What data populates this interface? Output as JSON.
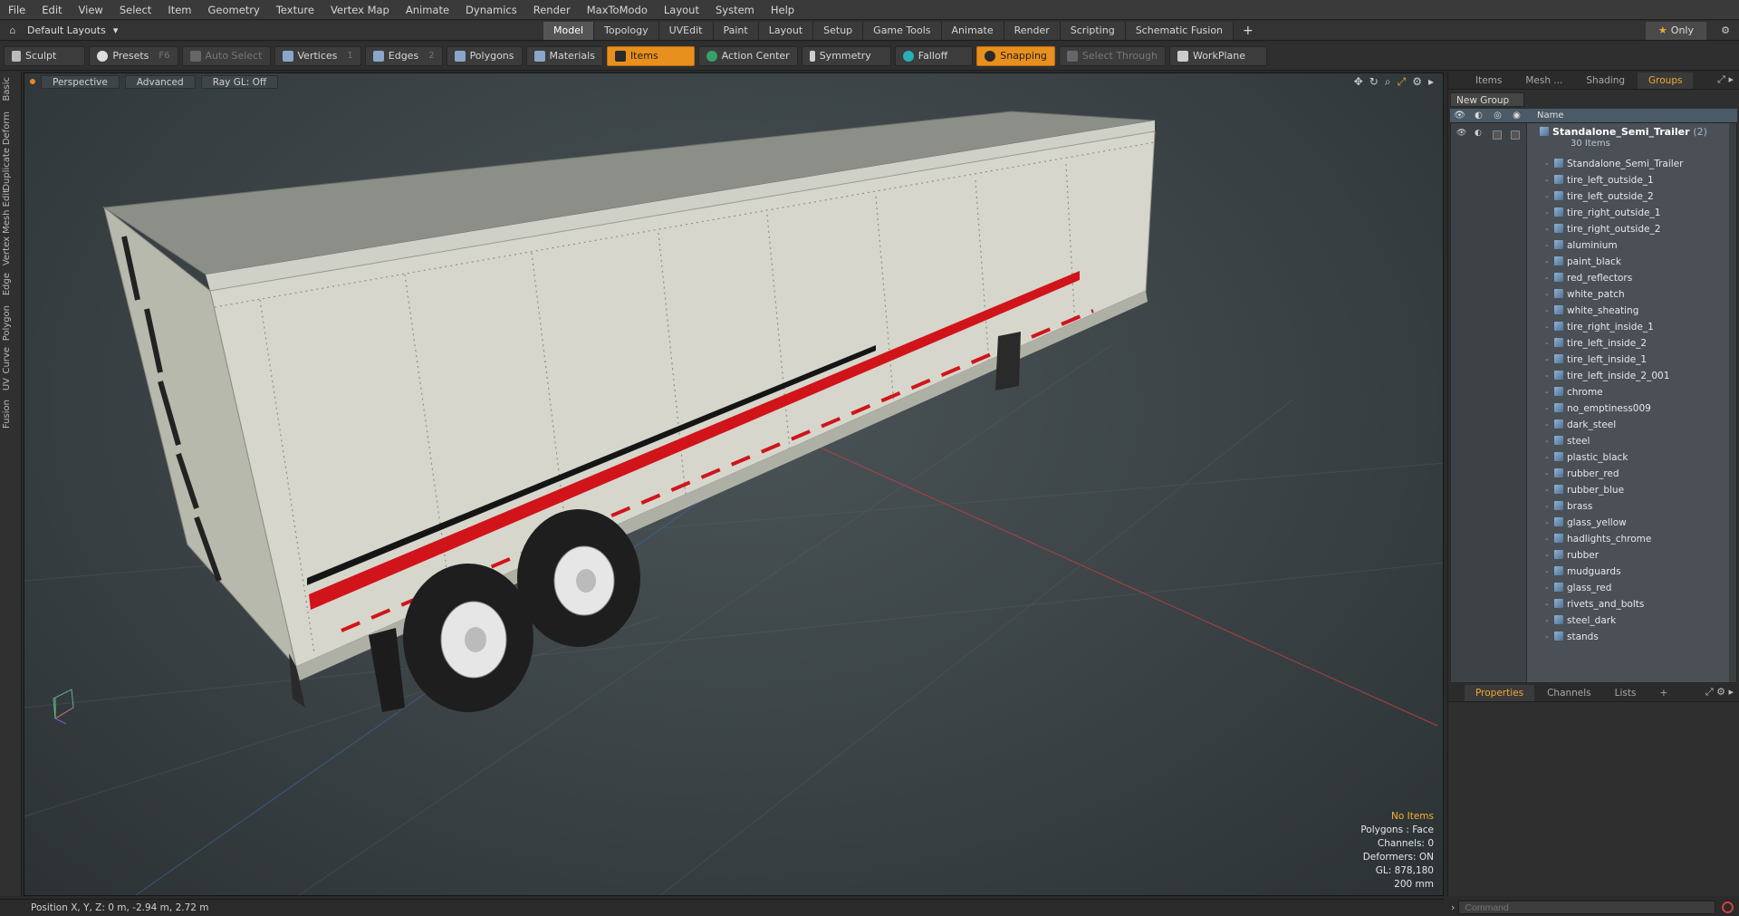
{
  "menu": [
    "File",
    "Edit",
    "View",
    "Select",
    "Item",
    "Geometry",
    "Texture",
    "Vertex Map",
    "Animate",
    "Dynamics",
    "Render",
    "MaxToModo",
    "Layout",
    "System",
    "Help"
  ],
  "layout_selector": "Default Layouts",
  "layout_tabs": [
    "Model",
    "Topology",
    "UVEdit",
    "Paint",
    "Layout",
    "Setup",
    "Game Tools",
    "Animate",
    "Render",
    "Scripting",
    "Schematic Fusion"
  ],
  "layout_tab_active": "Model",
  "only_label": "Only",
  "toolbar": {
    "sculpt": "Sculpt",
    "presets": "Presets",
    "presets_key": "F6",
    "auto_select": "Auto Select",
    "vertices": "Vertices",
    "vertices_key": "1",
    "edges": "Edges",
    "edges_key": "2",
    "polygons": "Polygons",
    "materials": "Materials",
    "items": "Items",
    "action_center": "Action Center",
    "symmetry": "Symmetry",
    "falloff": "Falloff",
    "snapping": "Snapping",
    "select_through": "Select Through",
    "workplane": "WorkPlane"
  },
  "left_tabs": [
    "Basic",
    "Deform",
    "Duplicate",
    "Mesh Edit",
    "Vertex",
    "Edge",
    "Polygon",
    "Curve",
    "UV",
    "Fusion"
  ],
  "viewport": {
    "view": "Perspective",
    "shading": "Advanced",
    "raygl": "Ray GL: Off",
    "stats": {
      "selection": "No Items",
      "polygons": "Polygons : Face",
      "channels": "Channels: 0",
      "deformers": "Deformers: ON",
      "gl": "GL: 878,180",
      "scale": "200 mm"
    }
  },
  "right_panel": {
    "tabs": [
      "Items",
      "Mesh ...",
      "Shading",
      "Groups"
    ],
    "active_tab": "Groups",
    "new_group": "New Group",
    "name_col": "Name",
    "group_name": "Standalone_Semi_Trailer",
    "group_count": "(2)",
    "group_sub": "30 Items",
    "items": [
      "Standalone_Semi_Trailer",
      "tire_left_outside_1",
      "tire_left_outside_2",
      "tire_right_outside_1",
      "tire_right_outside_2",
      "aluminium",
      "paint_black",
      "red_reflectors",
      "white_patch",
      "white_sheating",
      "tire_right_inside_1",
      "tire_left_inside_2",
      "tire_left_inside_1",
      "tire_left_inside_2_001",
      "chrome",
      "no_emptiness009",
      "dark_steel",
      "steel",
      "plastic_black",
      "rubber_red",
      "rubber_blue",
      "brass",
      "glass_yellow",
      "hadlights_chrome",
      "rubber",
      "mudguards",
      "glass_red",
      "rivets_and_bolts",
      "steel_dark",
      "stands"
    ],
    "lower_tabs": [
      "Properties",
      "Channels",
      "Lists"
    ],
    "lower_active": "Properties"
  },
  "command_placeholder": "Command",
  "status": "Position X, Y, Z:   0 m, -2.94 m, 2.72 m",
  "colors": {
    "accent": "#e8901d",
    "stripe_red": "#d0141a",
    "panel": "#2f2f2f"
  }
}
